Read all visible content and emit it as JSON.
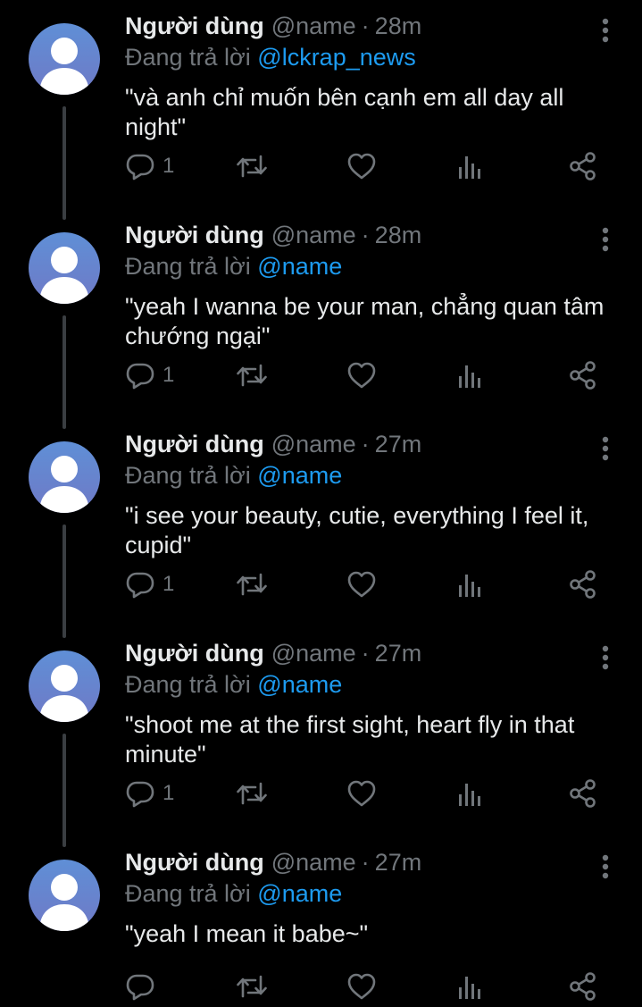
{
  "colors": {
    "background": "#000000",
    "text": "#e7e9ea",
    "secondary": "#71767b",
    "mention": "#1d9bf0",
    "thread_line": "#3a3e42"
  },
  "tweets": [
    {
      "display_name": "Người dùng",
      "handle": "@name",
      "separator": "·",
      "time": "28m",
      "replying_prefix": "Đang trả lời",
      "replying_to": "@lckrap_news",
      "text": "\"và anh chỉ muốn bên cạnh em all day all night\"",
      "reply_count": "1"
    },
    {
      "display_name": "Người dùng",
      "handle": "@name",
      "separator": "·",
      "time": "28m",
      "replying_prefix": "Đang trả lời",
      "replying_to": "@name",
      "text": "\"yeah I wanna be your man, chẳng quan tâm chướng ngại\"",
      "reply_count": "1"
    },
    {
      "display_name": "Người dùng",
      "handle": "@name",
      "separator": "·",
      "time": "27m",
      "replying_prefix": "Đang trả lời",
      "replying_to": "@name",
      "text": "\"i see your beauty, cutie, everything I feel it, cupid\"",
      "reply_count": "1"
    },
    {
      "display_name": "Người dùng",
      "handle": "@name",
      "separator": "·",
      "time": "27m",
      "replying_prefix": "Đang trả lời",
      "replying_to": "@name",
      "text": "\"shoot me at the first sight, heart fly in that minute\"",
      "reply_count": "1"
    },
    {
      "display_name": "Người dùng",
      "handle": "@name",
      "separator": "·",
      "time": "27m",
      "replying_prefix": "Đang trả lời",
      "replying_to": "@name",
      "text": "\"yeah I mean it babe~\"",
      "reply_count": ""
    }
  ],
  "icons": {
    "avatar": "default-user-avatar-icon",
    "more": "more-vertical-icon",
    "reply": "reply-bubble-icon",
    "retweet": "retweet-icon",
    "like": "heart-icon",
    "views": "views-bar-chart-icon",
    "share": "share-icon"
  }
}
